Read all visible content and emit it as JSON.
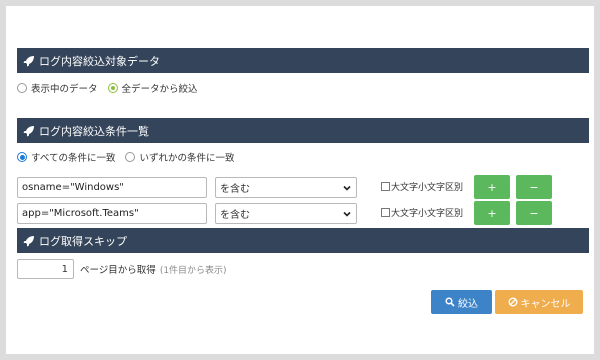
{
  "sections": {
    "target": {
      "title": "ログ内容絞込対象データ"
    },
    "conditions": {
      "title": "ログ内容絞込条件一覧"
    },
    "skip": {
      "title": "ログ取得スキップ"
    }
  },
  "target_options": [
    {
      "label": "表示中のデータ",
      "selected": false
    },
    {
      "label": "全データから絞込",
      "selected": true
    }
  ],
  "match_options": [
    {
      "label": "すべての条件に一致",
      "selected": true
    },
    {
      "label": "いずれかの条件に一致",
      "selected": false
    }
  ],
  "conditions": [
    {
      "value": "osname=\"Windows\"",
      "operator": "を含む",
      "case_label": "大文字小文字区別",
      "case_checked": false,
      "add_label": "+",
      "remove_label": "−"
    },
    {
      "value": "app=\"Microsoft.Teams\"",
      "operator": "を含む",
      "case_label": "大文字小文字区別",
      "case_checked": false,
      "add_label": "+",
      "remove_label": "−"
    }
  ],
  "skip": {
    "page_value": "1",
    "suffix": "ページ目から取得",
    "hint": "(1件目から表示)"
  },
  "actions": {
    "search_label": "絞込",
    "cancel_label": "キャンセル"
  },
  "colors": {
    "header": "#34445a",
    "green": "#5cb85c",
    "blue": "#3c83c8",
    "orange": "#f0ad4e"
  }
}
